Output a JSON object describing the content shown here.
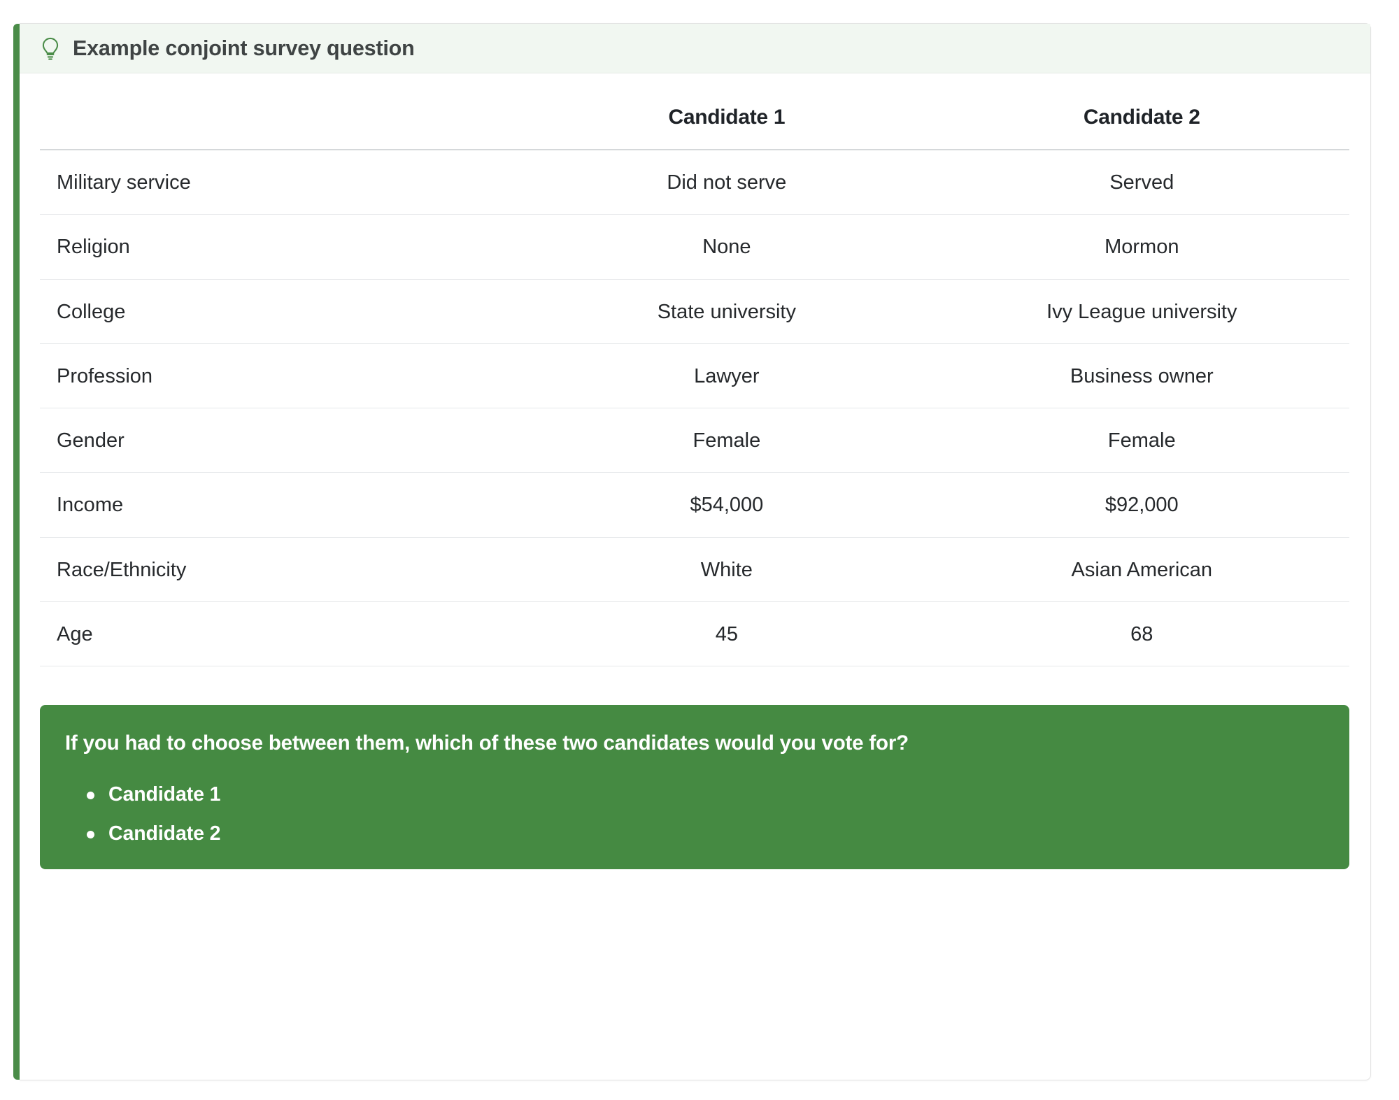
{
  "card": {
    "header": {
      "icon": "lightbulb-icon",
      "title": "Example conjoint survey question"
    },
    "accent_color": "#4a8c48",
    "header_background": "#f1f7f1"
  },
  "table": {
    "columns": [
      "",
      "Candidate 1",
      "Candidate 2"
    ],
    "attribute_header": "",
    "candidate_1_header": "Candidate 1",
    "candidate_2_header": "Candidate 2",
    "rows": [
      {
        "attribute": "Military service",
        "candidate_1": "Did not serve",
        "candidate_2": "Served"
      },
      {
        "attribute": "Religion",
        "candidate_1": "None",
        "candidate_2": "Mormon"
      },
      {
        "attribute": "College",
        "candidate_1": "State university",
        "candidate_2": "Ivy League university"
      },
      {
        "attribute": "Profession",
        "candidate_1": "Lawyer",
        "candidate_2": "Business owner"
      },
      {
        "attribute": "Gender",
        "candidate_1": "Female",
        "candidate_2": "Female"
      },
      {
        "attribute": "Income",
        "candidate_1": "$54,000",
        "candidate_2": "$92,000"
      },
      {
        "attribute": "Race/Ethnicity",
        "candidate_1": "White",
        "candidate_2": "Asian American"
      },
      {
        "attribute": "Age",
        "candidate_1": "45",
        "candidate_2": "68"
      }
    ]
  },
  "question": {
    "background_color": "#458a42",
    "text": "If you had to choose between them, which of these two candidates would you vote for?",
    "options": [
      "Candidate 1",
      "Candidate 2"
    ]
  }
}
